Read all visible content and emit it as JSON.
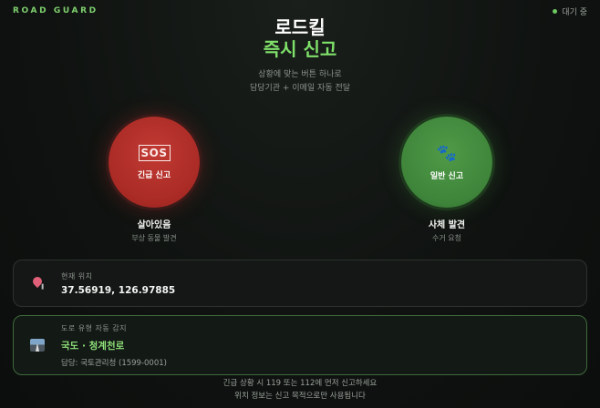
{
  "header": {
    "brand": "ROAD GUARD",
    "status": "대기 중",
    "status_color": "#6fc862"
  },
  "hero": {
    "title_line1": "로드킬",
    "title_line2": "즉시 신고",
    "subtitle_line1": "상황에 맞는 버튼 하나로",
    "subtitle_line2": "담당기관 + 이메일 자동 전달"
  },
  "actions": {
    "emergency": {
      "icon": "🆘",
      "icon_name": "sos-icon",
      "button_label": "긴급 신고",
      "name": "살아있음",
      "desc": "부상 동물 발견",
      "color": "#b02e28"
    },
    "normal": {
      "icon": "🐾",
      "icon_name": "paw-icon",
      "button_label": "일반 신고",
      "name": "사체 발견",
      "desc": "수거 요청",
      "color": "#438a3e"
    }
  },
  "location": {
    "label": "현재 위치",
    "coords": "37.56919, 126.97885",
    "icon_name": "pin-icon"
  },
  "road": {
    "label": "도로 유형 자동 감지",
    "name": "국도 · 청계천로",
    "agency": "담당: 국토관리청 (1599-0001)",
    "icon_name": "road-icon",
    "accent": "#8fe27a"
  },
  "footer": {
    "line1": "긴급 상황 시 119 또는 112에 먼저 신고하세요",
    "line2": "위치 정보는 신고 목적으로만 사용됩니다"
  }
}
